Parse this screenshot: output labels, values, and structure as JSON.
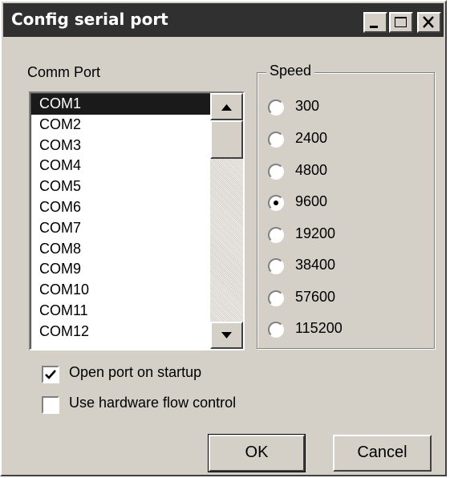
{
  "window": {
    "title": "Config serial port"
  },
  "titlebar_buttons": [
    {
      "name": "minimize-button",
      "icon": "minimize-icon"
    },
    {
      "name": "maximize-button",
      "icon": "maximize-icon"
    },
    {
      "name": "close-button",
      "icon": "close-icon"
    }
  ],
  "comm_port": {
    "label": "Comm Port",
    "selected": "COM1",
    "items": [
      "COM1",
      "COM2",
      "COM3",
      "COM4",
      "COM5",
      "COM6",
      "COM7",
      "COM8",
      "COM9",
      "COM10",
      "COM11",
      "COM12"
    ]
  },
  "speed": {
    "label": "Speed",
    "selected": "9600",
    "options": [
      "300",
      "2400",
      "4800",
      "9600",
      "19200",
      "38400",
      "57600",
      "115200"
    ]
  },
  "options": {
    "open_on_startup": {
      "label": "Open port on startup",
      "checked": true
    },
    "hardware_flow": {
      "label": "Use hardware flow control",
      "checked": false
    }
  },
  "buttons": {
    "ok": "OK",
    "cancel": "Cancel"
  }
}
